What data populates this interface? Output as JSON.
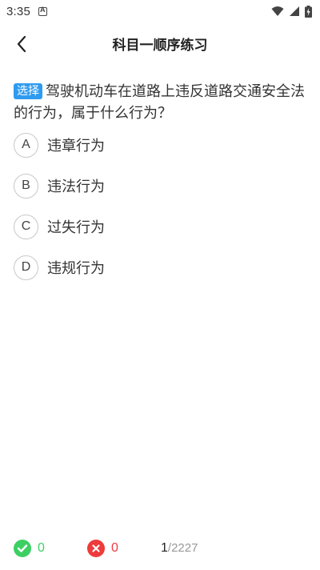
{
  "status_bar": {
    "time": "3:35",
    "icons": [
      "app-notification-icon",
      "wifi-icon",
      "signal-icon",
      "battery-charging-icon"
    ]
  },
  "header": {
    "title": "科目一顺序练习",
    "back_icon": "chevron-left-icon"
  },
  "question": {
    "type_badge": "选择",
    "text": "驾驶机动车在道路上违反道路交通安全法的行为，属于什么行为？",
    "options": [
      {
        "letter": "A",
        "text": "违章行为"
      },
      {
        "letter": "B",
        "text": "违法行为"
      },
      {
        "letter": "C",
        "text": "过失行为"
      },
      {
        "letter": "D",
        "text": "违规行为"
      }
    ]
  },
  "footer": {
    "correct_count": "0",
    "wrong_count": "0",
    "current": "1",
    "separator_total": "/2227"
  },
  "colors": {
    "badge": "#2f9bf0",
    "correct": "#3ccf63",
    "wrong": "#ee3b3b",
    "option_border": "#c8c8c8"
  }
}
